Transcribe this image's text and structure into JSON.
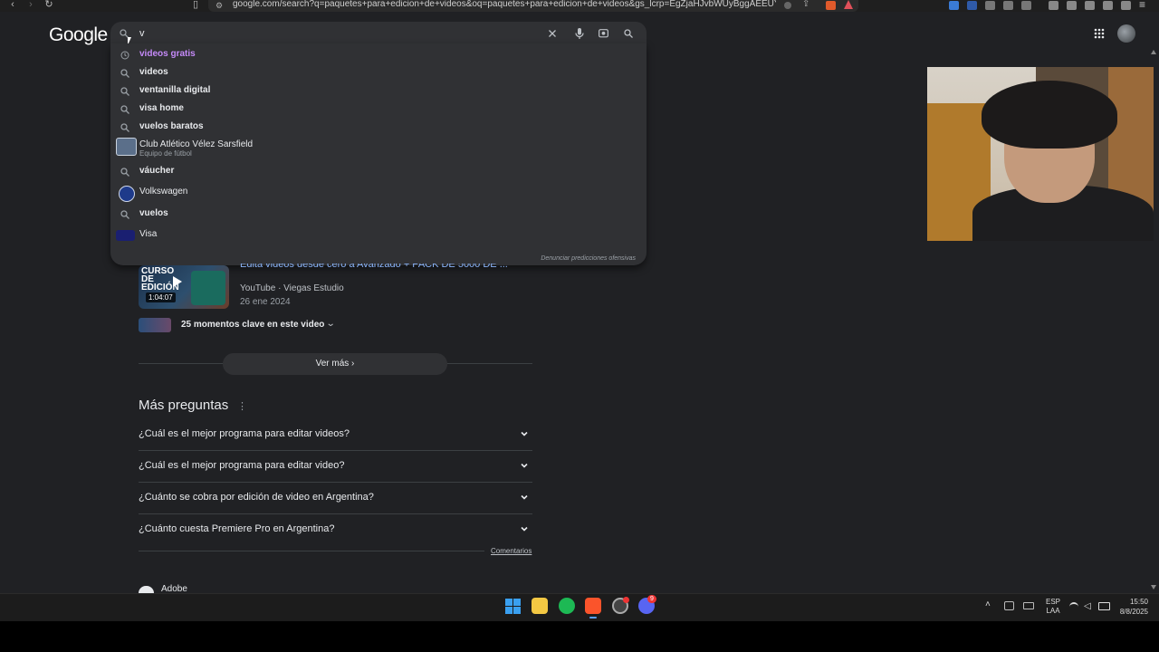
{
  "browser": {
    "url": "google.com/search?q=paquetes+para+edicion+de+videos&oq=paquetes+para+edicion+de+videos&gs_lcrp=EgZjaHJvbWUyBggAEEUYOTIGC..."
  },
  "google": {
    "logo": "Google",
    "search_value": "v",
    "suggestions": [
      {
        "text": "videos gratis",
        "icon": "history-icon",
        "visited": true
      },
      {
        "text": "videos",
        "icon": "search-icon"
      },
      {
        "text": "ventanilla digital",
        "icon": "search-icon"
      },
      {
        "text": "visa home",
        "icon": "search-icon"
      },
      {
        "text": "vuelos baratos",
        "icon": "search-icon"
      },
      {
        "text": "Club Atlético Vélez Sarsfield",
        "sub": "Equipo de fútbol",
        "icon": "velez-logo"
      },
      {
        "text": "váucher",
        "icon": "search-icon"
      },
      {
        "text": "Volkswagen",
        "icon": "volkswagen-logo"
      },
      {
        "text": "vuelos",
        "icon": "search-icon"
      },
      {
        "text": "Visa",
        "icon": "visa-logo"
      }
    ],
    "report_link": "Denunciar predicciones ofensivas"
  },
  "video_result": {
    "title_partial": "Edita videos desde cero a Avanzado + PACK DE 5000 DE ...",
    "thumb_label": "CURSO DE EDICIÓN",
    "duration": "1:04:07",
    "source": "YouTube · Viegas Estudio",
    "date": "26 ene 2024",
    "moments": "25 momentos clave en este video"
  },
  "ver_mas": "Ver más",
  "people_also_ask": {
    "heading": "Más preguntas",
    "questions": [
      "¿Cuál es el mejor programa para editar videos?",
      "¿Cuál es el mejor programa para editar video?",
      "¿Cuánto se cobra por edición de video en Argentina?",
      "¿Cuánto cuesta Premiere Pro en Argentina?"
    ],
    "feedback": "Comentarios"
  },
  "next_result": "Adobe",
  "taskbar": {
    "lang": "ESP",
    "lang_sub": "LAA",
    "time": "15:50",
    "date": "8/8/2025",
    "discord_badge": "9"
  },
  "colors": {
    "page_bg": "#202124",
    "search_bg": "#303134",
    "visited": "#c58af9"
  }
}
